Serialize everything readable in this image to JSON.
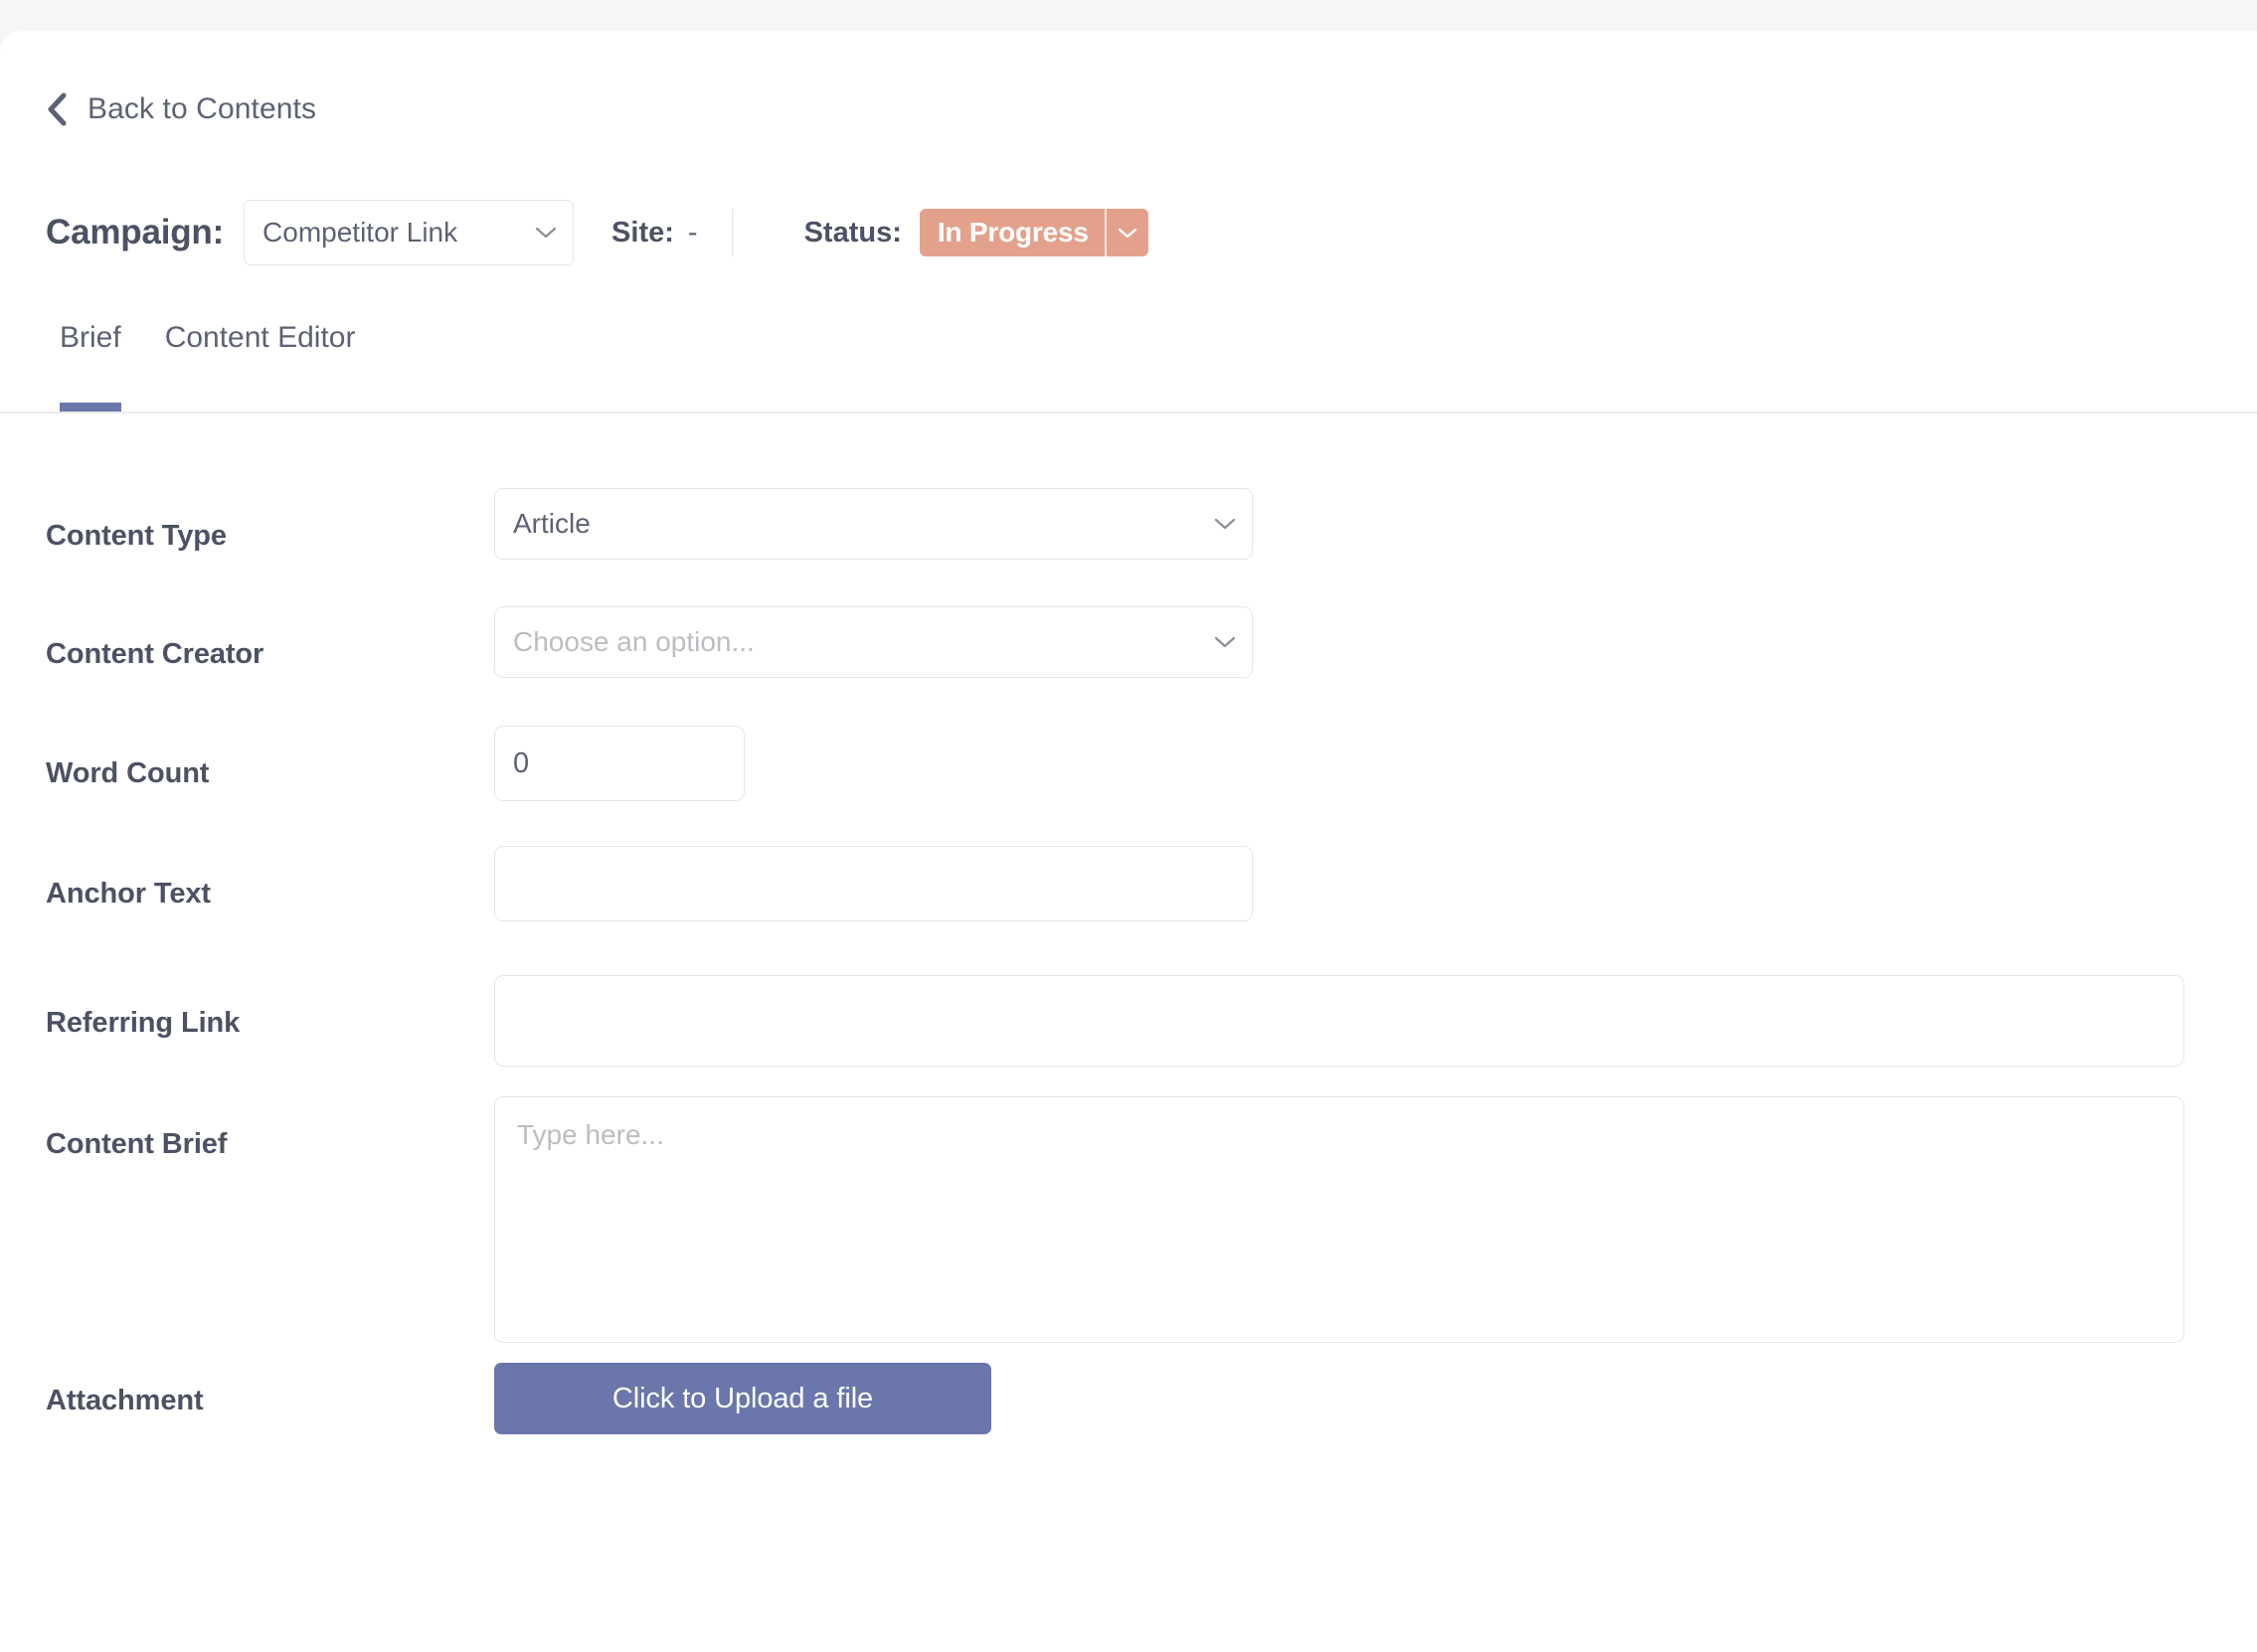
{
  "theme": {
    "page_background": "#f7f7f8",
    "panel_background": "#ffffff",
    "accent_purple": "#6b76ab",
    "status_salmon": "#e3a18c",
    "text_dark": "#4c5163",
    "text_muted": "#5c6274",
    "placeholder": "#bcbcc2",
    "border": "#e6e6ea"
  },
  "back_link": {
    "label": "Back to Contents",
    "icon": "chevron-left-icon"
  },
  "header": {
    "campaign_label": "Campaign:",
    "campaign_value": "Competitor Link",
    "campaign_caret_icon": "chevron-down-icon",
    "site_label": "Site:",
    "site_value": "-",
    "status_label": "Status:",
    "status_value": "In Progress",
    "status_caret_icon": "chevron-down-icon"
  },
  "tabs": [
    {
      "label": "Brief",
      "active": true
    },
    {
      "label": "Content Editor",
      "active": false
    }
  ],
  "form": {
    "content_type": {
      "label": "Content Type",
      "value": "Article",
      "caret_icon": "chevron-down-icon"
    },
    "content_creator": {
      "label": "Content Creator",
      "value": "",
      "placeholder": "Choose an option...",
      "caret_icon": "chevron-down-icon"
    },
    "word_count": {
      "label": "Word Count",
      "value": "0",
      "placeholder": ""
    },
    "anchor_text": {
      "label": "Anchor Text",
      "value": "",
      "placeholder": ""
    },
    "referring_link": {
      "label": "Referring Link",
      "value": "",
      "placeholder": ""
    },
    "content_brief": {
      "label": "Content Brief",
      "value": "",
      "placeholder": "Type here..."
    },
    "attachment": {
      "label": "Attachment",
      "button_label": "Click to Upload a file"
    }
  }
}
